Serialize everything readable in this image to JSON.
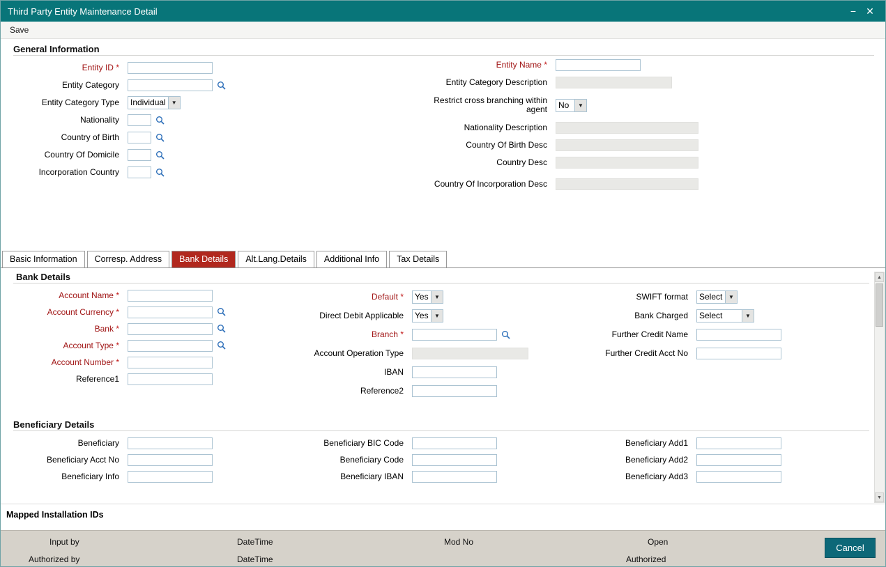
{
  "colors": {
    "titlebar": "#087579",
    "active_tab": "#b1281e",
    "required_label": "#a11616",
    "cancel_button": "#0d6878"
  },
  "icons": {
    "lookup": "magnifier",
    "dropdown_arrow": "▼",
    "scroll_up": "▲",
    "scroll_down": "▼",
    "minimize": "−",
    "close": "✕"
  },
  "required_marker": "*",
  "window": {
    "title": "Third Party Entity Maintenance Detail"
  },
  "toolbar": {
    "save": "Save"
  },
  "general": {
    "title": "General Information",
    "entity_id_label": "Entity ID",
    "entity_name_label": "Entity Name",
    "entity_category_label": "Entity Category",
    "entity_category_description_label": "Entity Category Description",
    "entity_category_type_label": "Entity Category Type",
    "entity_category_type_value": "Individual",
    "restrict_label": "Restrict cross branching within agent",
    "restrict_value": "No",
    "nationality_label": "Nationality",
    "nationality_description_label": "Nationality Description",
    "country_of_birth_label": "Country of Birth",
    "country_of_birth_desc_label": "Country Of Birth Desc",
    "country_of_domicile_label": "Country Of Domicile",
    "country_desc_label": "Country Desc",
    "incorporation_country_label": "Incorporation Country",
    "country_of_incorporation_desc_label": "Country Of Incorporation Desc"
  },
  "tabs": [
    {
      "label": "Basic Information"
    },
    {
      "label": "Corresp. Address"
    },
    {
      "label": "Bank Details"
    },
    {
      "label": "Alt.Lang.Details"
    },
    {
      "label": "Additional Info"
    },
    {
      "label": "Tax Details"
    }
  ],
  "bank": {
    "title": "Bank Details",
    "account_name_label": "Account Name",
    "account_currency_label": "Account Currency",
    "bank_label": "Bank",
    "account_type_label": "Account Type",
    "account_number_label": "Account Number",
    "reference1_label": "Reference1",
    "default_label": "Default",
    "default_value": "Yes",
    "direct_debit_label": "Direct Debit Applicable",
    "direct_debit_value": "Yes",
    "branch_label": "Branch",
    "account_operation_type_label": "Account Operation Type",
    "iban_label": "IBAN",
    "reference2_label": "Reference2",
    "swift_format_label": "SWIFT format",
    "swift_format_value": "Select",
    "bank_charged_label": "Bank Charged",
    "bank_charged_value": "Select",
    "further_credit_name_label": "Further Credit Name",
    "further_credit_acct_no_label": "Further Credit Acct No"
  },
  "beneficiary": {
    "title": "Beneficiary Details",
    "beneficiary_label": "Beneficiary",
    "beneficiary_acct_no_label": "Beneficiary Acct No",
    "beneficiary_info_label": "Beneficiary Info",
    "beneficiary_bic_code_label": "Beneficiary BIC Code",
    "beneficiary_code_label": "Beneficiary Code",
    "beneficiary_iban_label": "Beneficiary IBAN",
    "beneficiary_add1_label": "Beneficiary Add1",
    "beneficiary_add2_label": "Beneficiary Add2",
    "beneficiary_add3_label": "Beneficiary Add3"
  },
  "mapped_installation": {
    "title": "Mapped Installation IDs"
  },
  "footer": {
    "input_by": "Input by",
    "datetime_1": "DateTime",
    "mod_no": "Mod No",
    "open": "Open",
    "authorized_by": "Authorized by",
    "datetime_2": "DateTime",
    "authorized": "Authorized",
    "cancel": "Cancel"
  }
}
